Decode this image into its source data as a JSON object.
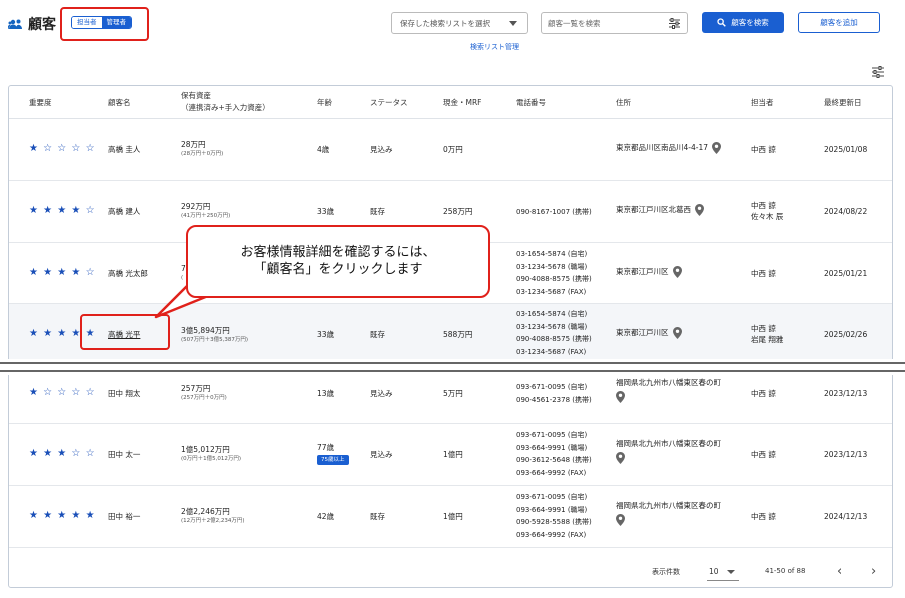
{
  "header": {
    "title": "顧客",
    "title_icon": "people-icon",
    "role_toggle": [
      "担当者",
      "管理者"
    ],
    "saved_list_select": "保存した検索リストを選択",
    "search_placeholder": "顧客一覧を検索",
    "search_button": "顧客を検索",
    "add_button": "顧客を追加",
    "manage_link": "検索リスト管理"
  },
  "table": {
    "columns": {
      "importance": "重要度",
      "name": "顧客名",
      "assets": "保有資産",
      "assets_sub": "（連携済み+手入力資産）",
      "age": "年齢",
      "status": "ステータス",
      "cash": "現金・MRF",
      "phone": "電話番号",
      "address": "住所",
      "staff": "担当者",
      "updated": "最終更新日"
    },
    "rows": [
      {
        "stars": "★ ☆ ☆ ☆ ☆",
        "name": "高橋 圭人",
        "assets": "28万円",
        "assets_sub": "(28万円＋0万円)",
        "age": "4歳",
        "status": "見込み",
        "cash": "0万円",
        "phones": [],
        "address": "東京都品川区南品川4-4-17",
        "staff": [
          "中西 諒"
        ],
        "updated": "2025/01/08"
      },
      {
        "stars": "★ ★ ★ ★ ☆",
        "name": "高橋 建人",
        "assets": "292万円",
        "assets_sub": "(41万円＋250万円)",
        "age": "33歳",
        "status": "既存",
        "cash": "258万円",
        "phones": [
          "090-8167-1007 (携帯)"
        ],
        "address": "東京都江戸川区北葛西",
        "staff": [
          "中西 諒",
          "佐々木 辰"
        ],
        "updated": "2024/08/22"
      },
      {
        "stars": "★ ★ ★ ★ ☆",
        "name": "高橋 光太郎",
        "assets": "7",
        "assets_sub": "(",
        "age": "",
        "status": "",
        "cash": "",
        "phones": [
          "03-1654-5874 (自宅)",
          "03-1234-5678 (職場)",
          "090-4088-8575 (携帯)",
          "03-1234-5687 (FAX)"
        ],
        "address": "東京都江戸川区",
        "staff": [
          "中西 諒"
        ],
        "updated": "2025/01/21"
      },
      {
        "stars": "★ ★ ★ ★ ★",
        "name": "高橋 光平",
        "assets": "3億5,894万円",
        "assets_sub": "(507万円＋3億5,387万円)",
        "age": "33歳",
        "status": "既存",
        "cash": "588万円",
        "phones": [
          "03-1654-5874 (自宅)",
          "03-1234-5678 (職場)",
          "090-4088-8575 (携帯)",
          "03-1234-5687 (FAX)"
        ],
        "address": "東京都江戸川区",
        "staff": [
          "中西 諒",
          "岩尾 翔雅"
        ],
        "updated": "2025/02/26"
      },
      {
        "stars": "★ ☆ ☆ ☆ ☆",
        "name": "田中 翔太",
        "assets": "257万円",
        "assets_sub": "(257万円＋0万円)",
        "age": "13歳",
        "status": "見込み",
        "cash": "5万円",
        "phones": [
          "093-671-0095 (自宅)",
          "090-4561-2378 (携帯)"
        ],
        "address": "福岡県北九州市八幡東区春の町",
        "staff": [
          "中西 諒"
        ],
        "updated": "2023/12/13"
      },
      {
        "stars": "★ ★ ★ ☆ ☆",
        "name": "田中 太一",
        "assets": "1億5,012万円",
        "assets_sub": "(0万円＋1億5,012万円)",
        "age": "77歳",
        "age_badge": "75歳以上",
        "status": "見込み",
        "cash": "1億円",
        "phones": [
          "093-671-0095 (自宅)",
          "093-664-9991 (職場)",
          "090-3612-5648 (携帯)",
          "093-664-9992 (FAX)"
        ],
        "address": "福岡県北九州市八幡東区春の町",
        "staff": [
          "中西 諒"
        ],
        "updated": "2023/12/13"
      },
      {
        "stars": "★ ★ ★ ★ ★",
        "name": "田中 裕一",
        "assets": "2億2,246万円",
        "assets_sub": "(12万円＋2億2,234万円)",
        "age": "42歳",
        "status": "既存",
        "cash": "1億円",
        "phones": [
          "093-671-0095 (自宅)",
          "093-664-9991 (職場)",
          "090-5928-5588 (携帯)",
          "093-664-9992 (FAX)"
        ],
        "address": "福岡県北九州市八幡東区春の町",
        "staff": [
          "中西 諒"
        ],
        "updated": "2024/12/13"
      }
    ]
  },
  "pagination": {
    "per_page_label": "表示件数",
    "per_page": "10",
    "range": "41-50 of 88",
    "prev": "‹",
    "next": "›"
  },
  "callout": {
    "line1": "お客様情報詳細を確認するには、",
    "line2": "「顧客名」をクリックします"
  },
  "colors": {
    "primary": "#1a5fd1",
    "annotation_red": "#e0211b"
  }
}
